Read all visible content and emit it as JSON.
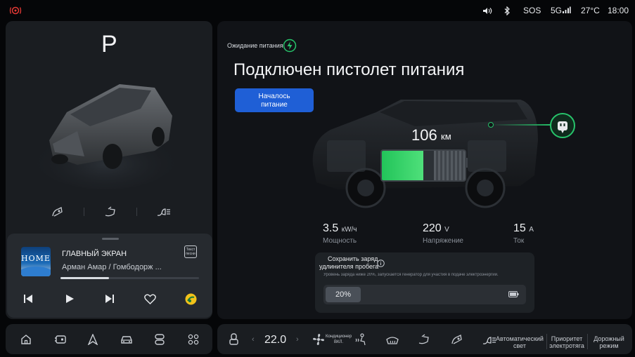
{
  "status": {
    "volume_icon": "volume-icon",
    "bluetooth_icon": "bluetooth-icon",
    "sos": "SOS",
    "network": "5G",
    "temperature": "27°C",
    "time": "18:00",
    "alert_color": "#e53935"
  },
  "vehicle": {
    "gear": "P",
    "controls": [
      "charge-port-icon",
      "trunk-icon",
      "headlight-icon"
    ]
  },
  "media": {
    "album_text": "HOME",
    "title": "ГЛАВНЫЙ ЭКРАН",
    "artist": "Арман Амар / Гомбодорж ...",
    "progress": 0.35,
    "lyrics_label": "Текст песни"
  },
  "charging": {
    "status_label": "Ожидание питания",
    "headline": "Подключен пистолет питания",
    "start_button": "Началось питание",
    "range_value": "106",
    "range_unit": "км",
    "battery_level": 0.5,
    "accent": "#27c46b",
    "metrics": [
      {
        "value": "3.5",
        "unit": "кW/ч",
        "label": "Мощность"
      },
      {
        "value": "220",
        "unit": "V",
        "label": "Напряжение"
      },
      {
        "value": "15",
        "unit": "A",
        "label": "Ток"
      }
    ],
    "save_title_line1": "Сохранить заряд",
    "save_title_line2": "удлинителя пробега",
    "save_desc": "Уровень заряда ниже 20%, запускается генератор для участия в подаче электроэнергии.",
    "save_value": "20%"
  },
  "climate": {
    "temp": "22.0",
    "fan_label_1": "Кондиционер",
    "fan_label_2": "ВКЛ.",
    "auto_light_1": "Автоматический",
    "auto_light_2": "свет",
    "priority_1": "Приоритет",
    "priority_2": "электротяга",
    "road_1": "Дорожный",
    "road_2": "режим"
  },
  "nav": {
    "items": [
      "home-icon",
      "vehicle-icon",
      "navigation-icon",
      "car-icon",
      "controls-icon",
      "apps-icon"
    ]
  }
}
